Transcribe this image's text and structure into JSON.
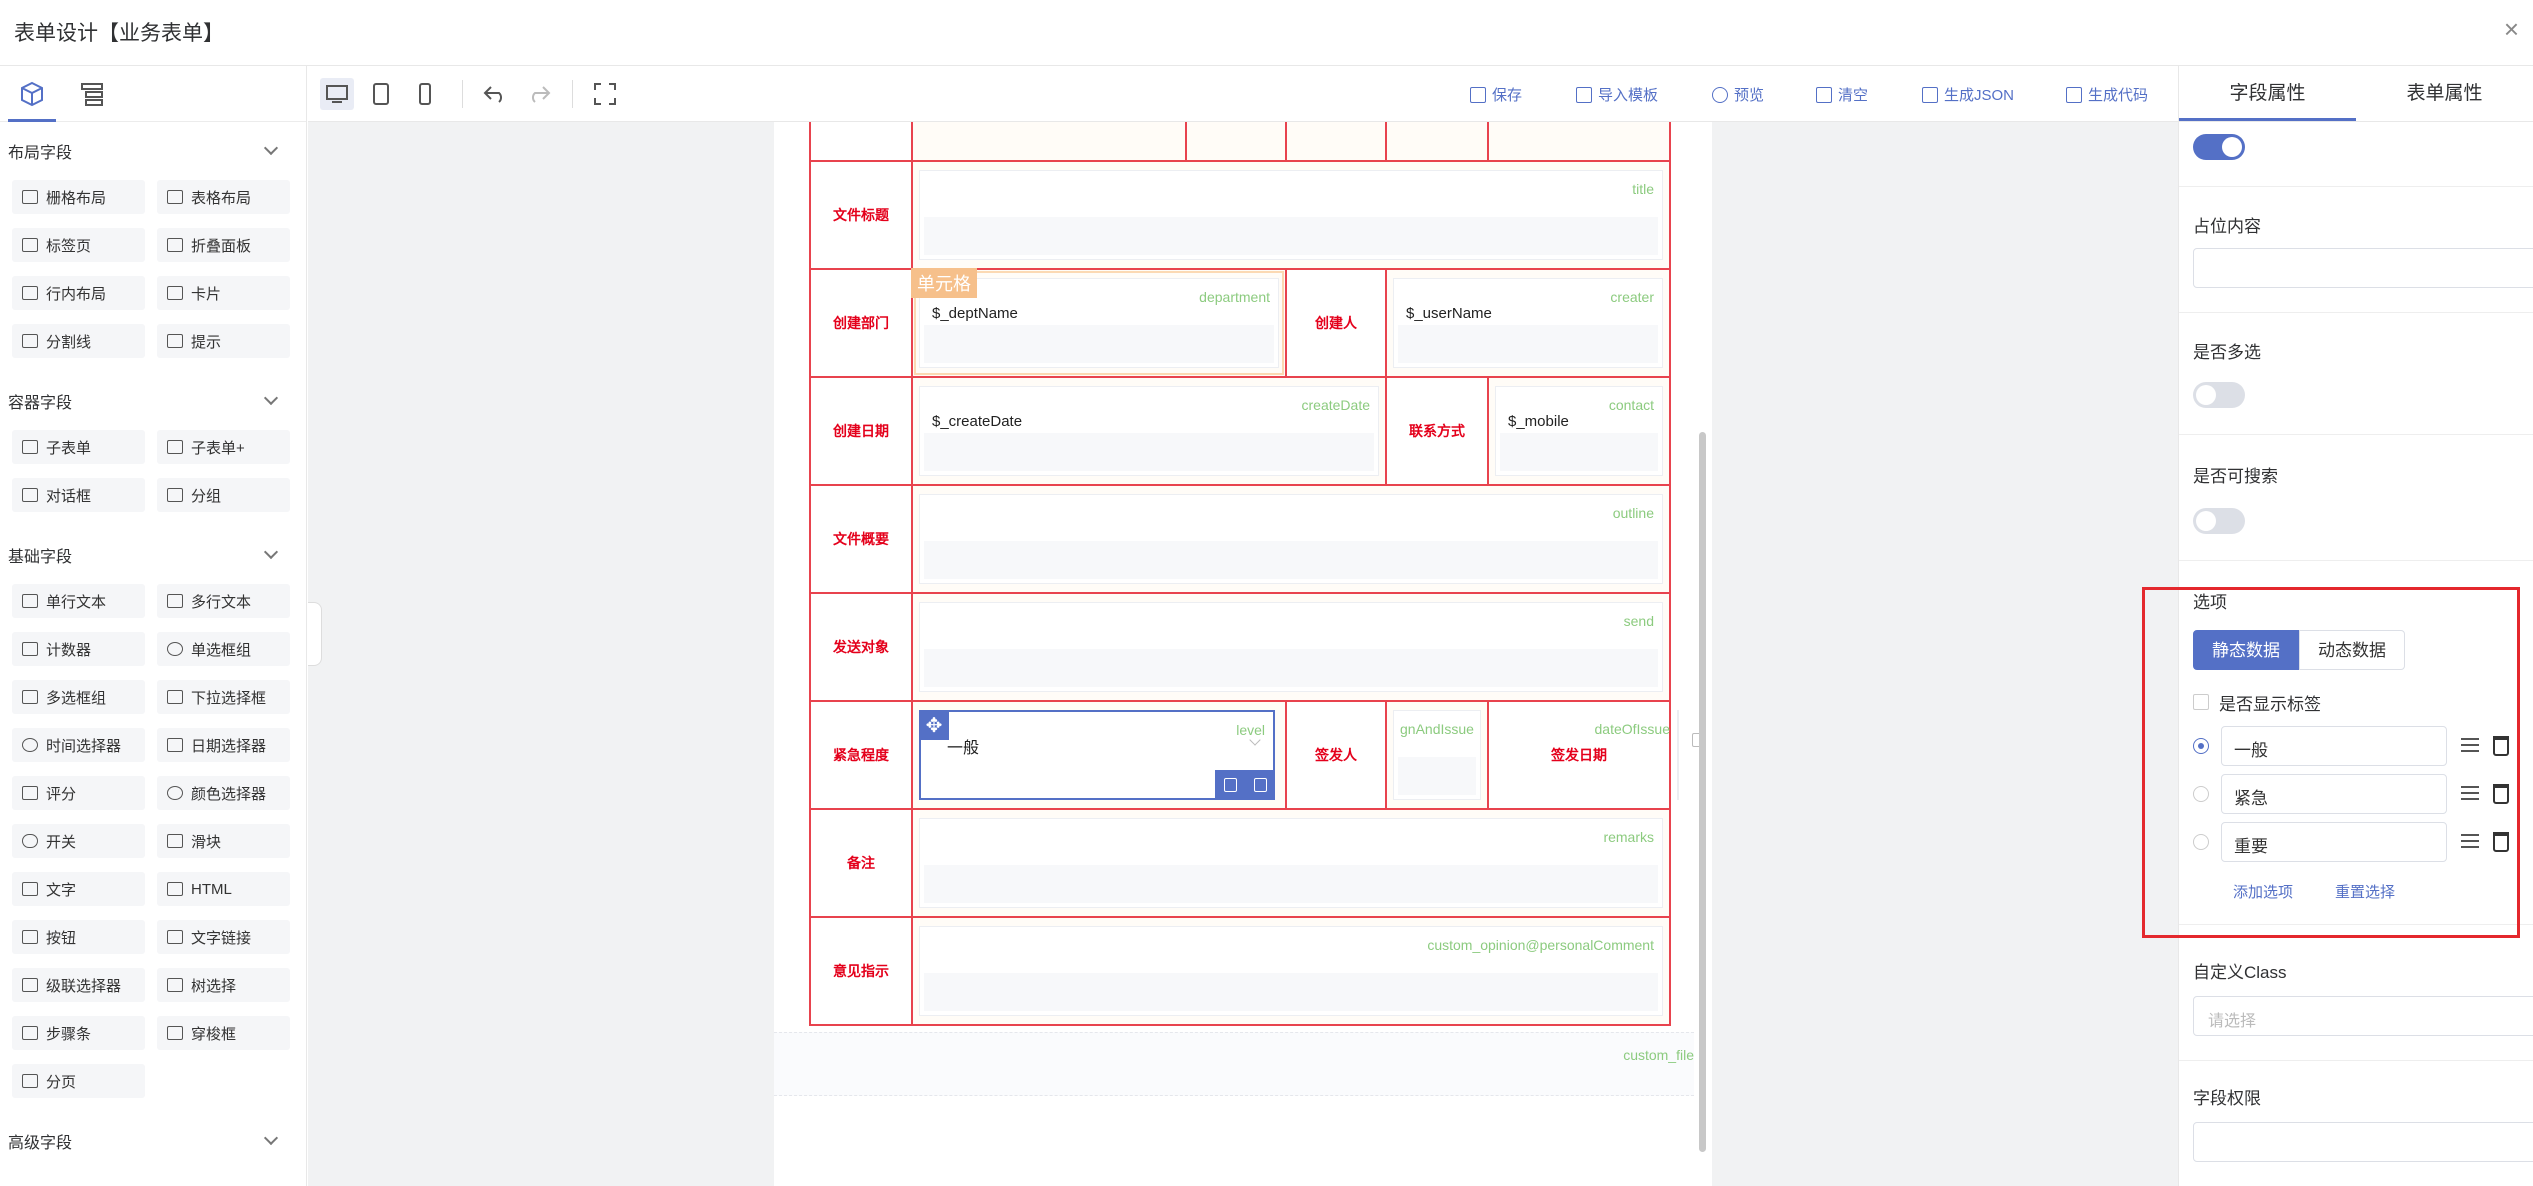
{
  "window": {
    "title": "表单设计【业务表单】",
    "close_glyph": "×"
  },
  "palette": {
    "groups": [
      {
        "title": "布局字段",
        "items": [
          "栅格布局",
          "表格布局",
          "标签页",
          "折叠面板",
          "行内布局",
          "卡片",
          "分割线",
          "提示"
        ]
      },
      {
        "title": "容器字段",
        "items": [
          "子表单",
          "子表单+",
          "对话框",
          "分组"
        ]
      },
      {
        "title": "基础字段",
        "items": [
          "单行文本",
          "多行文本",
          "计数器",
          "单选框组",
          "多选框组",
          "下拉选择框",
          "时间选择器",
          "日期选择器",
          "评分",
          "颜色选择器",
          "开关",
          "滑块",
          "文字",
          "HTML",
          "按钮",
          "文字链接",
          "级联选择器",
          "树选择",
          "步骤条",
          "穿梭框",
          "分页"
        ]
      },
      {
        "title": "高级字段",
        "items": []
      }
    ]
  },
  "toolbar": {
    "save": "保存",
    "import": "导入模板",
    "preview": "预览",
    "clear": "清空",
    "gen_json": "生成JSON",
    "gen_code": "生成代码"
  },
  "form": {
    "cell_marker": "单元格",
    "rows": {
      "title": {
        "label": "文件标题",
        "field": "title"
      },
      "dept": {
        "label": "创建部门",
        "field": "department",
        "value": "$_deptName",
        "label2": "创建人",
        "field2": "creater",
        "value2": "$_userName"
      },
      "date": {
        "label": "创建日期",
        "field": "createDate",
        "value": "$_createDate",
        "label2": "联系方式",
        "field2": "contact",
        "value2": "$_mobile"
      },
      "outline": {
        "label": "文件概要",
        "field": "outline"
      },
      "send": {
        "label": "发送对象",
        "field": "send"
      },
      "level": {
        "label": "紧急程度",
        "field": "level",
        "value": "一般",
        "label2": "签发人",
        "field2": "gnAndIssue",
        "label3": "签发日期",
        "field3": "dateOfIssue"
      },
      "remarks": {
        "label": "备注",
        "field": "remarks"
      },
      "opinion": {
        "label": "意见指示",
        "field": "custom_opinion@personalComment"
      }
    },
    "custom_file": "custom_file"
  },
  "props": {
    "tabs": [
      "字段属性",
      "表单属性"
    ],
    "placeholder_label": "占位内容",
    "multiple_label": "是否多选",
    "searchable_label": "是否可搜索",
    "options_label": "选项",
    "static_data": "静态数据",
    "dynamic_data": "动态数据",
    "show_label": "是否显示标签",
    "options": [
      "一般",
      "紧急",
      "重要"
    ],
    "add_option": "添加选项",
    "reset_option": "重置选择",
    "custom_class_label": "自定义Class",
    "custom_class_placeholder": "请选择",
    "permission_label": "字段权限"
  }
}
